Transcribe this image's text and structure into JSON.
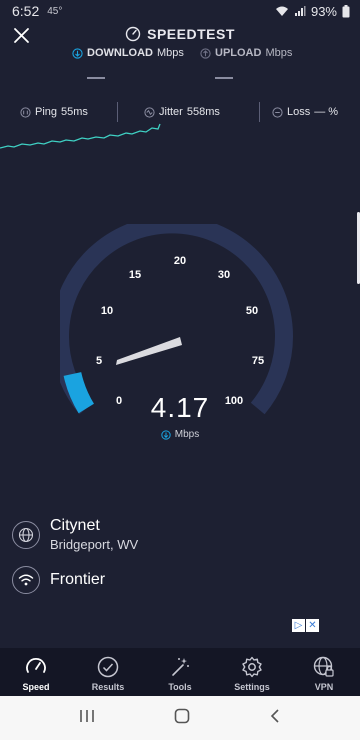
{
  "status_bar": {
    "time": "6:52",
    "temp": "45°",
    "battery": "93%"
  },
  "header": {
    "title": "SPEEDTEST"
  },
  "metrics": {
    "download_label": "DOWNLOAD",
    "download_unit": "Mbps",
    "upload_label": "UPLOAD",
    "upload_unit": "Mbps"
  },
  "stats": {
    "ping_label": "Ping",
    "ping_value": "55ms",
    "jitter_label": "Jitter",
    "jitter_value": "558ms",
    "loss_label": "Loss",
    "loss_value": "— %"
  },
  "gauge": {
    "ticks": [
      "0",
      "5",
      "10",
      "15",
      "20",
      "30",
      "50",
      "75",
      "100"
    ],
    "current_speed": "4.17",
    "unit": "Mbps",
    "accent_color": "#1aa3e0",
    "track_color": "#2a3456"
  },
  "provider": {
    "isp": "Citynet",
    "location": "Bridgeport, WV",
    "host": "Frontier"
  },
  "nav": [
    {
      "label": "Speed",
      "icon": "speed-icon"
    },
    {
      "label": "Results",
      "icon": "check-circle-icon"
    },
    {
      "label": "Tools",
      "icon": "wand-icon"
    },
    {
      "label": "Settings",
      "icon": "gear-icon"
    },
    {
      "label": "VPN",
      "icon": "globe-icon"
    }
  ]
}
